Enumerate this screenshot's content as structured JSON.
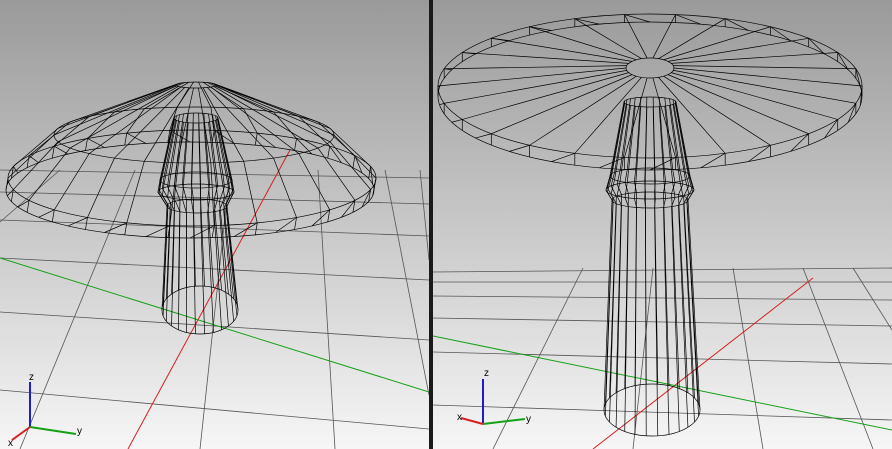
{
  "viewports": [
    {
      "id": "left",
      "axis_labels": {
        "x": "x",
        "y": "y",
        "z": "z"
      }
    },
    {
      "id": "right",
      "axis_labels": {
        "x": "x",
        "y": "y",
        "z": "z"
      }
    }
  ],
  "colors": {
    "background_top": "#9c9c9c",
    "background_bottom": "#f4f4f4",
    "grid": "#555555",
    "wire": "#000000",
    "axis_x": "#d62020",
    "axis_y": "#16a016",
    "axis_z": "#1e1ec8"
  },
  "object": "mushroom-wireframe"
}
